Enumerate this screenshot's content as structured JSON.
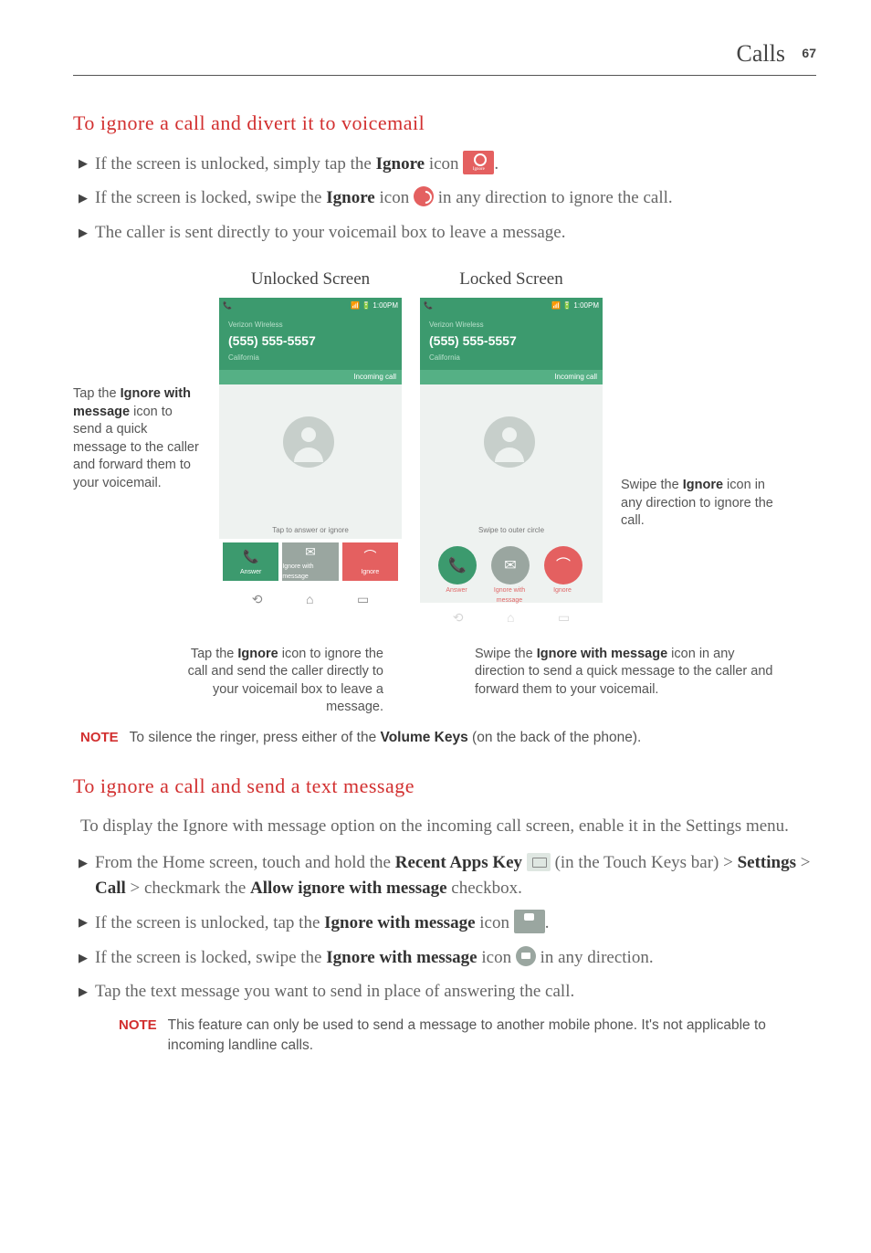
{
  "header": {
    "section": "Calls",
    "page": "67"
  },
  "h1": "To ignore a call and divert it to voicemail",
  "b1a": "If the screen is unlocked, simply tap the ",
  "b1b": "Ignore",
  "b1c": " icon ",
  "b1d": ".",
  "b2a": "If the screen is locked, swipe the ",
  "b2b": "Ignore",
  "b2c": " icon ",
  "b2d": " in any direction to ignore the call.",
  "b3": "The caller is sent directly to your voicemail box to leave a message.",
  "fig": {
    "unlocked_title": "Unlocked Screen",
    "locked_title": "Locked Screen",
    "status_time": "1:00PM",
    "carrier": "Verizon Wireless",
    "number": "(555) 555-5557",
    "location": "California",
    "incoming": "Incoming call",
    "hint_unlocked": "Tap to answer or ignore",
    "hint_locked": "Swipe to outer circle",
    "btn_answer": "Answer",
    "btn_ignore_msg": "Ignore with message",
    "btn_ignore": "Ignore",
    "left_anno_a": "Tap the ",
    "left_anno_b": "Ignore with message",
    "left_anno_c": " icon to send a quick message to the caller and forward them to your voicemail.",
    "right_anno_a": "Swipe the ",
    "right_anno_b": "Ignore",
    "right_anno_c": " icon in any direction to ignore the call.",
    "cap_left_a": "Tap the ",
    "cap_left_b": "Ignore",
    "cap_left_c": " icon to ignore the call and send the caller directly to your voicemail box to leave a message.",
    "cap_right_a": "Swipe the ",
    "cap_right_b": "Ignore with message",
    "cap_right_c": " icon in any direction to send a quick message to the caller and forward them to your voicemail."
  },
  "note1a": "NOTE",
  "note1b": "To silence the ringer, press either of the ",
  "note1c": "Volume Keys",
  "note1d": " (on the back of the phone).",
  "h2": "To ignore a call and send a text message",
  "p2": "To display the Ignore with message option on the incoming call screen, enable it in the Settings menu.",
  "c1a": "From the Home screen, touch and hold the ",
  "c1b": "Recent Apps Key",
  "c1c": " (in the Touch Keys bar) > ",
  "c1d": "Settings",
  "c1e": " > ",
  "c1f": "Call",
  "c1g": " > checkmark the ",
  "c1h": "Allow ignore with message",
  "c1i": " checkbox.",
  "c2a": "If the screen is unlocked, tap the ",
  "c2b": "Ignore with message",
  "c2c": " icon ",
  "c2d": ".",
  "c3a": "If the screen is locked, swipe the ",
  "c3b": "Ignore with message",
  "c3c": " icon ",
  "c3d": " in any direction.",
  "c4": "Tap the text message you want to send in place of answering the call.",
  "note2a": "NOTE",
  "note2b": "This feature can only be used to send a message to another mobile phone. It's not applicable to incoming landline calls."
}
